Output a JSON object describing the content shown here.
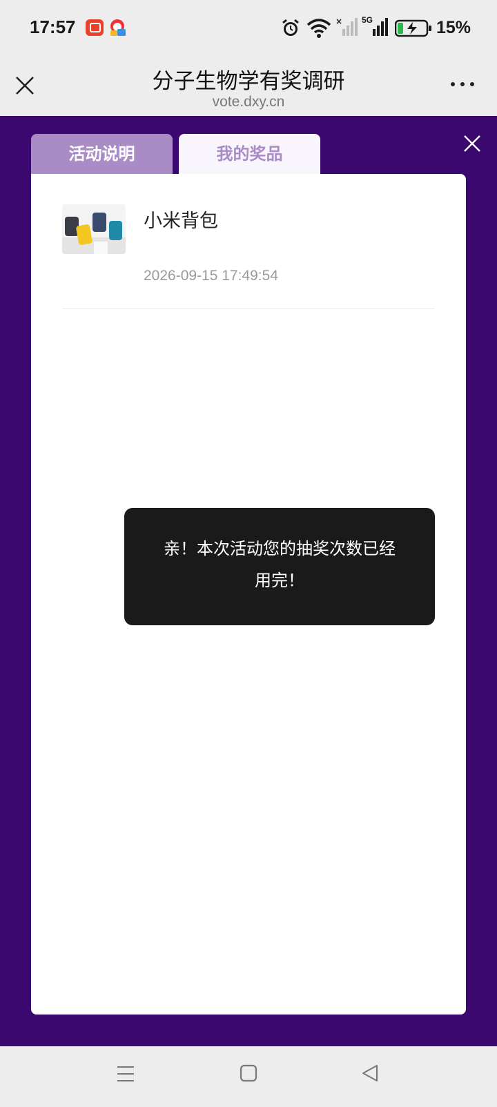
{
  "status_bar": {
    "time": "17:57",
    "battery": "15%",
    "network": "5G",
    "icons": [
      "app-notification-icon",
      "app-notification-icon-2",
      "alarm-icon",
      "wifi-icon",
      "no-signal-icon",
      "signal-icon",
      "battery-charging-icon"
    ]
  },
  "title_bar": {
    "title": "分子生物学有奖调研",
    "url": "vote.dxy.cn"
  },
  "tabs": [
    {
      "label": "活动说明",
      "active": false
    },
    {
      "label": "我的奖品",
      "active": true
    }
  ],
  "prizes": [
    {
      "name": "小米背包",
      "time": "2026-09-15 17:49:54"
    }
  ],
  "toast": {
    "line1": "亲！本次活动您的抽奖次数已经",
    "line2": "用完！"
  },
  "colors": {
    "background": "#3b0870",
    "tab_inactive": "#a98bc6",
    "tab_active_bg": "#f8f5fc",
    "toast_bg": "#1a1a1a"
  }
}
